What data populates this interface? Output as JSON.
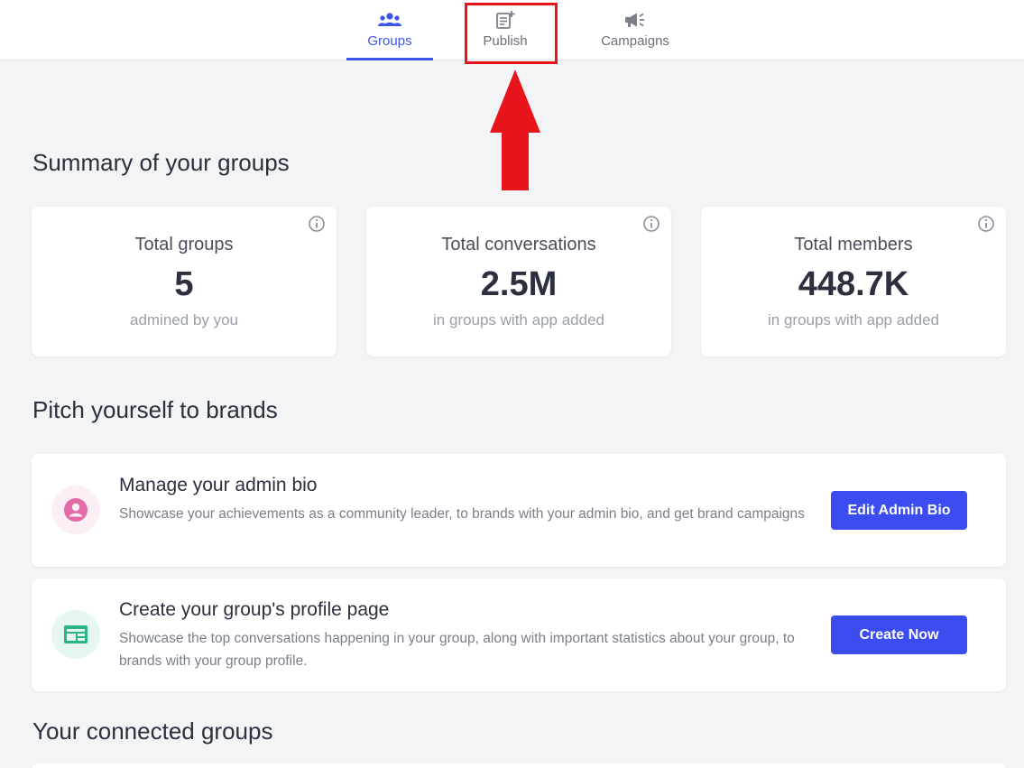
{
  "nav": {
    "tabs": [
      {
        "label": "Groups",
        "icon": "users-icon",
        "active": true
      },
      {
        "label": "Publish",
        "icon": "document-add-icon",
        "active": false
      },
      {
        "label": "Campaigns",
        "icon": "megaphone-icon",
        "active": false
      }
    ]
  },
  "sections": {
    "summary_title": "Summary of your groups",
    "pitch_title": "Pitch yourself to brands",
    "connected_title": "Your connected groups"
  },
  "stats": [
    {
      "title": "Total groups",
      "value": "5",
      "subtitle": "admined by you"
    },
    {
      "title": "Total conversations",
      "value": "2.5M",
      "subtitle": "in groups with app added"
    },
    {
      "title": "Total members",
      "value": "448.7K",
      "subtitle": "in groups with app added"
    }
  ],
  "pitch": [
    {
      "title": "Manage your admin bio",
      "description": "Showcase your achievements as a community leader, to brands with your admin bio, and get brand campaigns",
      "button": "Edit Admin Bio",
      "icon": "user-circle-icon"
    },
    {
      "title": "Create your group's profile page",
      "description": "Showcase the top conversations happening in your group, along with important statistics about your group, to brands with your group profile.",
      "button": "Create Now",
      "icon": "profile-page-icon"
    }
  ],
  "colors": {
    "accent": "#3b55e6",
    "button": "#3b4cf0",
    "highlight": "#e8141b",
    "background": "#f3f4f6"
  }
}
